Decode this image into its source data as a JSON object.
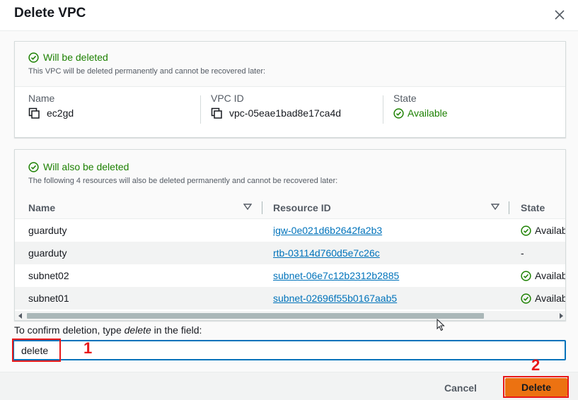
{
  "dialog": {
    "title": "Delete VPC",
    "close_icon": "close-icon"
  },
  "vpc_panel": {
    "heading": "Will be deleted",
    "description": "This VPC will be deleted permanently and cannot be recovered later:",
    "name_label": "Name",
    "name_value": "ec2gd",
    "vpc_id_label": "VPC ID",
    "vpc_id_value": "vpc-05eae1bad8e17ca4d",
    "state_label": "State",
    "state_value": "Available"
  },
  "resources_panel": {
    "heading": "Will also be deleted",
    "description": "The following 4 resources will also be deleted permanently and cannot be recovered later:",
    "columns": [
      "Name",
      "Resource ID",
      "State"
    ],
    "rows": [
      {
        "name": "guarduty",
        "resource_id": "igw-0e021d6b2642fa2b3",
        "state": "Availab"
      },
      {
        "name": "guarduty",
        "resource_id": "rtb-03114d760d5e7c26c",
        "state": "-"
      },
      {
        "name": "subnet02",
        "resource_id": "subnet-06e7c12b2312b2885",
        "state": "Availab"
      },
      {
        "name": "subnet01",
        "resource_id": "subnet-02696f55b0167aab5",
        "state": "Availab"
      }
    ]
  },
  "confirm": {
    "label_prefix": "To confirm deletion, type ",
    "label_keyword": "delete",
    "label_suffix": " in the field:",
    "input_value": "delete"
  },
  "annotations": {
    "step1": "1",
    "step2": "2"
  },
  "footer": {
    "cancel_label": "Cancel",
    "delete_label": "Delete"
  },
  "colors": {
    "success": "#1d8102",
    "link": "#0073bb",
    "primary": "#ec7211",
    "annotation": "#e8191a"
  }
}
